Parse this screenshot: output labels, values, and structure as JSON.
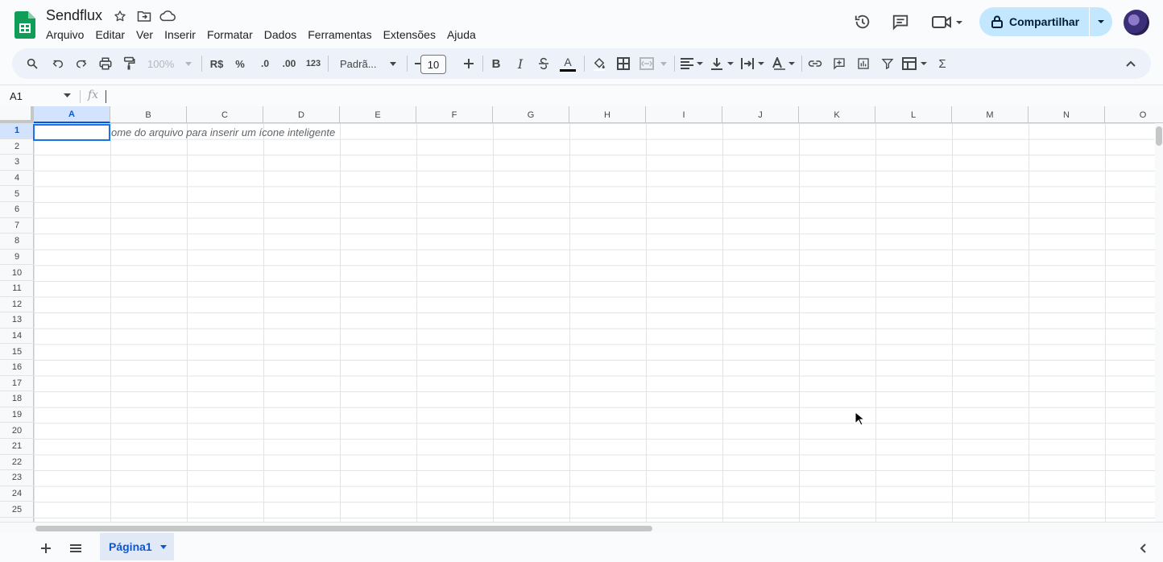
{
  "app": {
    "doc_title": "Sendflux",
    "menu": [
      "Arquivo",
      "Editar",
      "Ver",
      "Inserir",
      "Formatar",
      "Dados",
      "Ferramentas",
      "Extensões",
      "Ajuda"
    ],
    "share_label": "Compartilhar",
    "accent_color": "#0b57d0",
    "share_bg": "#c2e7ff"
  },
  "toolbar": {
    "zoom": "100%",
    "currency": "R$",
    "percent": "%",
    "decimal_decrease": ".0",
    "decimal_increase": ".00",
    "number_format": "123",
    "font": "Padrã...",
    "font_size": "10",
    "bold": "B",
    "italic": "I",
    "text_color_letter": "A",
    "sum_symbol": "Σ"
  },
  "formula_bar": {
    "name_box": "A1",
    "fx": "fx",
    "value": ""
  },
  "grid": {
    "columns": [
      "A",
      "B",
      "C",
      "D",
      "E",
      "F",
      "G",
      "H",
      "I",
      "J",
      "K",
      "L",
      "M",
      "N",
      "O"
    ],
    "rows": [
      "1",
      "2",
      "3",
      "4",
      "5",
      "6",
      "7",
      "8",
      "9",
      "10",
      "11",
      "12",
      "13",
      "14",
      "15",
      "16",
      "17",
      "18",
      "19",
      "20",
      "21",
      "22",
      "23",
      "24",
      "25"
    ],
    "selected_column": "A",
    "selected_row": "1",
    "hint_text": "ome do arquivo para inserir um ícone inteligente"
  },
  "sheets": {
    "tabs": [
      "Página1"
    ]
  }
}
